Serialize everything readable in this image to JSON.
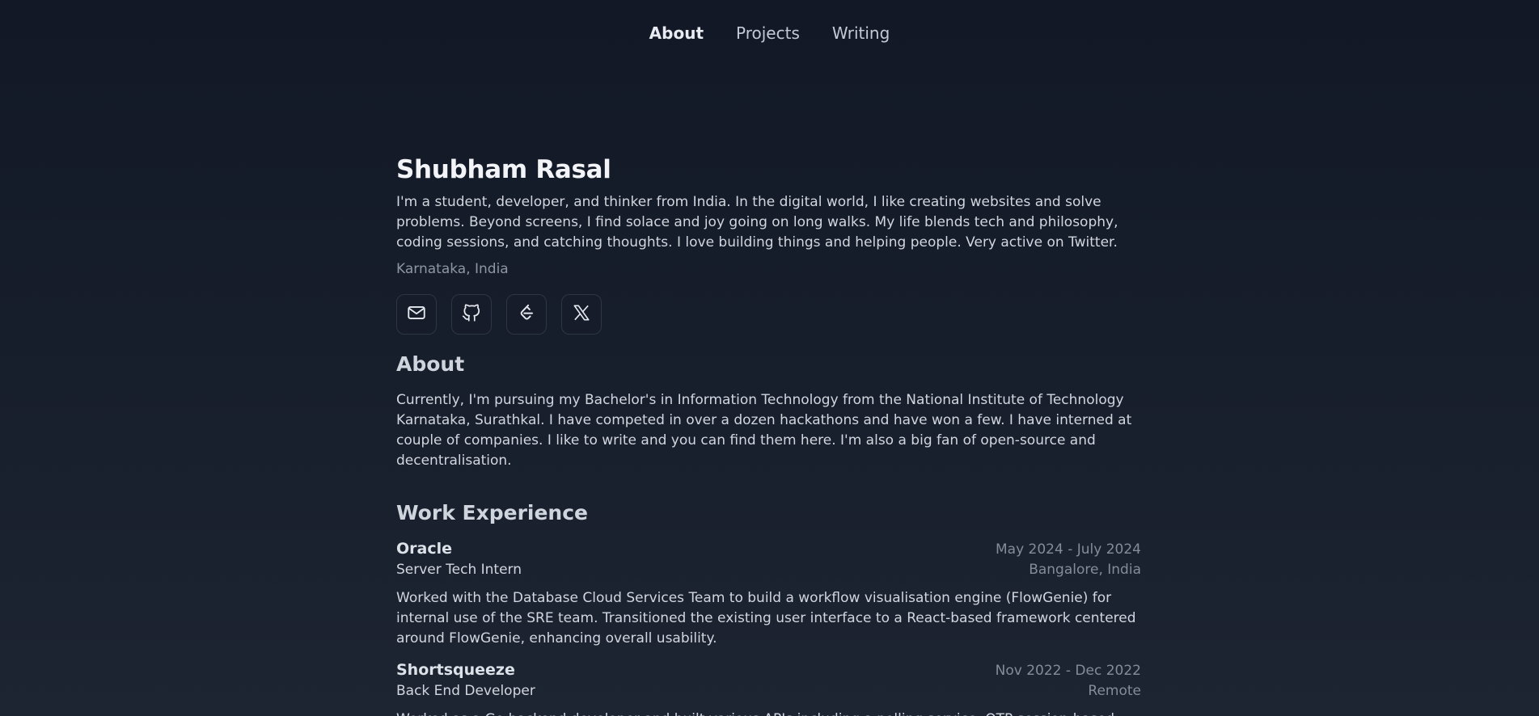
{
  "nav": {
    "items": [
      {
        "label": "About"
      },
      {
        "label": "Projects"
      },
      {
        "label": "Writing"
      }
    ]
  },
  "profile": {
    "name": "Shubham Rasal",
    "intro": "I'm a student, developer, and thinker from India. In the digital world, I like creating websites and solve problems. Beyond screens, I find solace and joy going on long walks. My life blends tech and philosophy, coding sessions, and catching thoughts. I love building things and helping people. Very active on Twitter.",
    "location": "Karnataka, India",
    "socials": [
      {
        "icon": "mail-icon"
      },
      {
        "icon": "github-icon"
      },
      {
        "icon": "leetcode-icon"
      },
      {
        "icon": "x-twitter-icon"
      }
    ]
  },
  "about": {
    "heading": "About",
    "text": "Currently, I'm pursuing my Bachelor's in Information Technology from the National Institute of Technology Karnataka, Surathkal. I have competed in over a dozen hackathons and have won a few. I have interned at couple of companies. I like to write and you can find them here. I'm also a big fan of open-source and decentralisation."
  },
  "work": {
    "heading": "Work Experience",
    "jobs": [
      {
        "company": "Oracle",
        "dates": "May 2024 - July 2024",
        "role": "Server Tech Intern",
        "place": "Bangalore, India",
        "description": "Worked with the Database Cloud Services Team to build a workflow visualisation engine (FlowGenie) for internal use of the SRE team. Transitioned the existing user interface to a React-based framework centered around FlowGenie, enhancing overall usability."
      },
      {
        "company": "Shortsqueeze",
        "dates": "Nov 2022 - Dec 2022",
        "role": "Back End Developer",
        "place": "Remote",
        "description": "Worked as a Go backend developer and built various APIs including a polling service, OTP session-based"
      }
    ]
  },
  "colors": {
    "background": "#161d2b",
    "text": "#d2d6de",
    "muted": "#858c99",
    "heading": "#f3f4f7"
  }
}
